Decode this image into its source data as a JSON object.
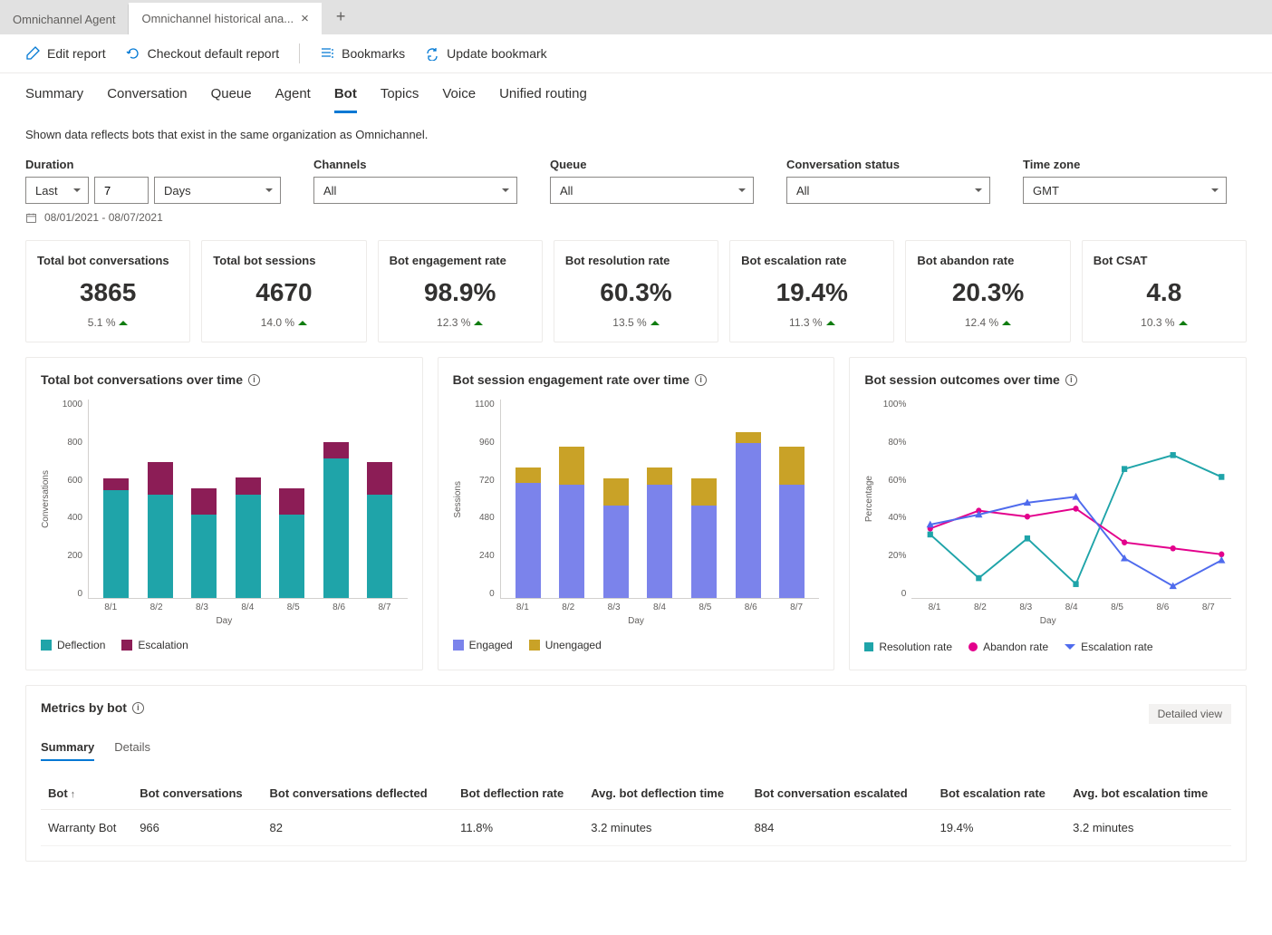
{
  "colors": {
    "teal": "#1fa4a9",
    "maroon": "#8c1d56",
    "purple": "#7b83eb",
    "gold": "#c9a227",
    "magenta": "#e3008c",
    "blue": "#4f6bed"
  },
  "tabs": {
    "inactive": "Omnichannel Agent",
    "active": "Omnichannel historical ana..."
  },
  "toolbar": {
    "edit": "Edit report",
    "checkout": "Checkout default report",
    "bookmarks": "Bookmarks",
    "update": "Update bookmark"
  },
  "nav": [
    "Summary",
    "Conversation",
    "Queue",
    "Agent",
    "Bot",
    "Topics",
    "Voice",
    "Unified routing"
  ],
  "nav_active": 4,
  "note": "Shown data reflects bots that exist in the same organization as Omnichannel.",
  "filters": {
    "duration": {
      "label": "Duration",
      "mode": "Last",
      "value": "7",
      "unit": "Days"
    },
    "channels": {
      "label": "Channels",
      "value": "All"
    },
    "queue": {
      "label": "Queue",
      "value": "All"
    },
    "status": {
      "label": "Conversation status",
      "value": "All"
    },
    "tz": {
      "label": "Time zone",
      "value": "GMT"
    }
  },
  "daterange": "08/01/2021 - 08/07/2021",
  "kpis": [
    {
      "title": "Total bot conversations",
      "value": "3865",
      "trend": "5.1 %"
    },
    {
      "title": "Total bot sessions",
      "value": "4670",
      "trend": "14.0 %"
    },
    {
      "title": "Bot engagement rate",
      "value": "98.9%",
      "trend": "12.3 %"
    },
    {
      "title": "Bot resolution rate",
      "value": "60.3%",
      "trend": "13.5 %"
    },
    {
      "title": "Bot escalation rate",
      "value": "19.4%",
      "trend": "11.3 %"
    },
    {
      "title": "Bot abandon rate",
      "value": "20.3%",
      "trend": "12.4 %"
    },
    {
      "title": "Bot CSAT",
      "value": "4.8",
      "trend": "10.3 %"
    }
  ],
  "chart_data": [
    {
      "id": "conversations",
      "type": "bar",
      "title": "Total bot conversations over time",
      "xlabel": "Day",
      "ylabel": "Conversations",
      "ylim": [
        0,
        1000
      ],
      "yticks": [
        0,
        200,
        400,
        600,
        800,
        1000
      ],
      "categories": [
        "8/1",
        "8/2",
        "8/3",
        "8/4",
        "8/5",
        "8/6",
        "8/7"
      ],
      "series": [
        {
          "name": "Deflection",
          "color": "#1fa4a9",
          "values": [
            595,
            570,
            460,
            570,
            460,
            770,
            570
          ]
        },
        {
          "name": "Escalation",
          "color": "#8c1d56",
          "values": [
            65,
            180,
            145,
            95,
            145,
            90,
            180
          ]
        }
      ],
      "legend": [
        "Deflection",
        "Escalation"
      ]
    },
    {
      "id": "engagement",
      "type": "bar",
      "title": "Bot session engagement rate over time",
      "xlabel": "Day",
      "ylabel": "Sessions",
      "ylim": [
        0,
        1100
      ],
      "yticks": [
        0,
        240,
        480,
        720,
        960,
        1100
      ],
      "categories": [
        "8/1",
        "8/2",
        "8/3",
        "8/4",
        "8/5",
        "8/6",
        "8/7"
      ],
      "series": [
        {
          "name": "Engaged",
          "color": "#7b83eb",
          "values": [
            700,
            690,
            560,
            690,
            560,
            940,
            690
          ]
        },
        {
          "name": "Unengaged",
          "color": "#c9a227",
          "values": [
            90,
            230,
            165,
            100,
            165,
            65,
            230
          ]
        }
      ],
      "legend": [
        "Engaged",
        "Unengaged"
      ]
    },
    {
      "id": "outcomes",
      "type": "line",
      "title": "Bot session outcomes over time",
      "xlabel": "Day",
      "ylabel": "Percentage",
      "ylim": [
        0,
        100
      ],
      "yticks": [
        "0",
        "20%",
        "40%",
        "60%",
        "80%",
        "100%"
      ],
      "categories": [
        "8/1",
        "8/2",
        "8/3",
        "8/4",
        "8/5",
        "8/6",
        "8/7"
      ],
      "series": [
        {
          "name": "Resolution rate",
          "color": "#1fa4a9",
          "marker": "square",
          "values": [
            32,
            10,
            30,
            7,
            65,
            72,
            61
          ]
        },
        {
          "name": "Abandon rate",
          "color": "#e3008c",
          "marker": "circle",
          "values": [
            35,
            44,
            41,
            45,
            28,
            25,
            22
          ]
        },
        {
          "name": "Escalation rate",
          "color": "#4f6bed",
          "marker": "triangle",
          "values": [
            37,
            42,
            48,
            51,
            20,
            6,
            19
          ]
        }
      ],
      "legend": [
        "Resolution rate",
        "Abandon rate",
        "Escalation rate"
      ]
    }
  ],
  "metrics": {
    "title": "Metrics by bot",
    "detailed": "Detailed view",
    "subtabs": [
      "Summary",
      "Details"
    ],
    "columns": [
      "Bot",
      "Bot conversations",
      "Bot conversations deflected",
      "Bot deflection rate",
      "Avg. bot deflection time",
      "Bot conversation escalated",
      "Bot escalation rate",
      "Avg. bot escalation time"
    ],
    "rows": [
      [
        "Warranty Bot",
        "966",
        "82",
        "11.8%",
        "3.2 minutes",
        "884",
        "19.4%",
        "3.2 minutes"
      ]
    ]
  }
}
